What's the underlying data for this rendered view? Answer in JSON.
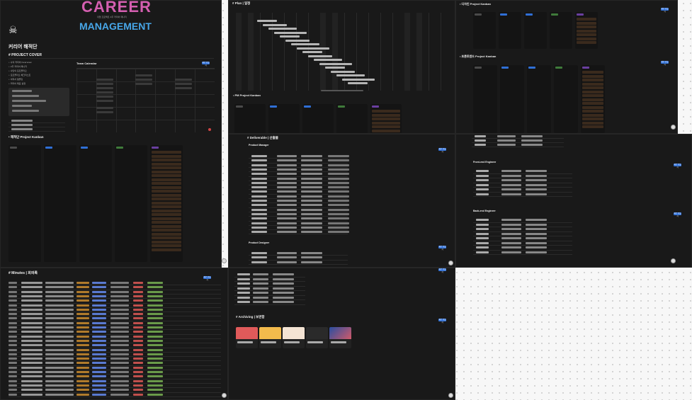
{
  "colors": {
    "bg": "#191919",
    "accent": "#2f6fd6",
    "canvas": "#f7f7f7"
  },
  "header": {
    "banner_line1": "CAREER",
    "banner_line2": "MANAGEMENT",
    "banner_sub": "취업 프로젝트 2주 커리어 매니저",
    "page_title": "커리어 해적단"
  },
  "cover": {
    "title": "# PROJECT COVER",
    "team_calendar": "Team Calendar",
    "kanban_title": "• 해적단 Project Kanban"
  },
  "plan": {
    "title": "# Plan | 일정",
    "pm_kanban": "• PM Project Kanban"
  },
  "deliverable": {
    "title": "# Deliverable | 산출물",
    "pm_section": "Product Manager",
    "pd_section": "Product Designer"
  },
  "archiving": {
    "title": "# Archiving | 보관함"
  },
  "minutes": {
    "title": "# Minutes | 회의록"
  },
  "design": {
    "kanban_title": "• 디자인 Project Kanban",
    "frontend_kanban": "• 프론트엔드 Project Kanban"
  },
  "engineers": {
    "fe": "Front-end Engineer",
    "be": "Back-end Engineer"
  },
  "buttons": {
    "new": "새로 만들기"
  }
}
